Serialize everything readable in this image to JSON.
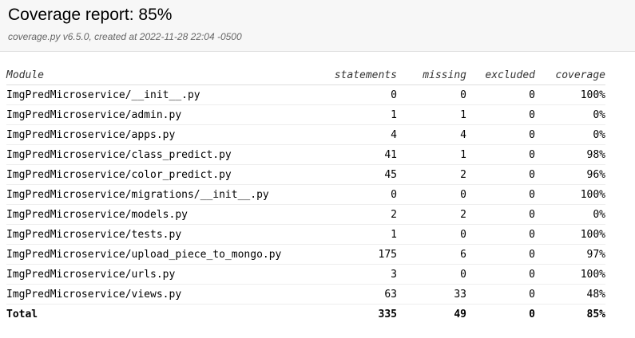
{
  "header": {
    "title": "Coverage report: 85%",
    "meta": "coverage.py v6.5.0, created at 2022-11-28 22:04 -0500"
  },
  "table": {
    "columns": [
      "Module",
      "statements",
      "missing",
      "excluded",
      "coverage"
    ],
    "rows": [
      {
        "module": "ImgPredMicroservice/__init__.py",
        "statements": "0",
        "missing": "0",
        "excluded": "0",
        "coverage": "100%"
      },
      {
        "module": "ImgPredMicroservice/admin.py",
        "statements": "1",
        "missing": "1",
        "excluded": "0",
        "coverage": "0%"
      },
      {
        "module": "ImgPredMicroservice/apps.py",
        "statements": "4",
        "missing": "4",
        "excluded": "0",
        "coverage": "0%"
      },
      {
        "module": "ImgPredMicroservice/class_predict.py",
        "statements": "41",
        "missing": "1",
        "excluded": "0",
        "coverage": "98%"
      },
      {
        "module": "ImgPredMicroservice/color_predict.py",
        "statements": "45",
        "missing": "2",
        "excluded": "0",
        "coverage": "96%"
      },
      {
        "module": "ImgPredMicroservice/migrations/__init__.py",
        "statements": "0",
        "missing": "0",
        "excluded": "0",
        "coverage": "100%"
      },
      {
        "module": "ImgPredMicroservice/models.py",
        "statements": "2",
        "missing": "2",
        "excluded": "0",
        "coverage": "0%"
      },
      {
        "module": "ImgPredMicroservice/tests.py",
        "statements": "1",
        "missing": "0",
        "excluded": "0",
        "coverage": "100%"
      },
      {
        "module": "ImgPredMicroservice/upload_piece_to_mongo.py",
        "statements": "175",
        "missing": "6",
        "excluded": "0",
        "coverage": "97%"
      },
      {
        "module": "ImgPredMicroservice/urls.py",
        "statements": "3",
        "missing": "0",
        "excluded": "0",
        "coverage": "100%"
      },
      {
        "module": "ImgPredMicroservice/views.py",
        "statements": "63",
        "missing": "33",
        "excluded": "0",
        "coverage": "48%"
      }
    ],
    "total": {
      "module": "Total",
      "statements": "335",
      "missing": "49",
      "excluded": "0",
      "coverage": "85%"
    }
  }
}
